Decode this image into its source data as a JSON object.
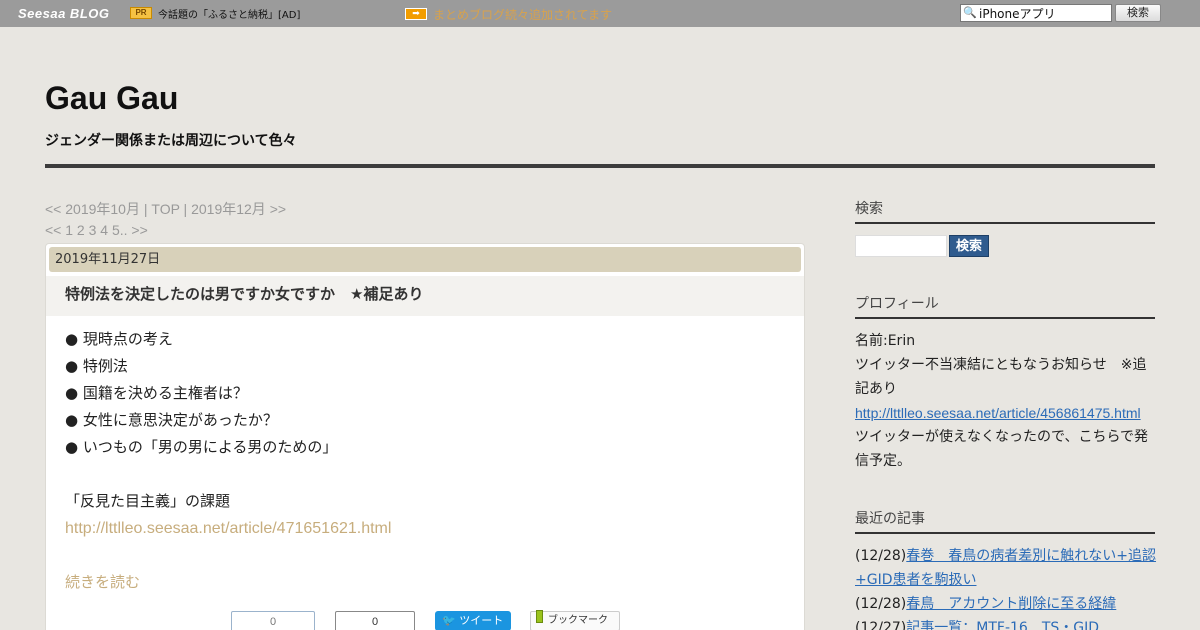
{
  "topbar": {
    "logo": "Seesaa BLOG",
    "pr_badge": "PR",
    "ad_text": "今話題の「ふるさと納税」[AD]",
    "arrow_badge": "➡",
    "news": "まとめブログ続々追加されてます",
    "search_value": "iPhoneアプリ",
    "search_button": "検索"
  },
  "header": {
    "title": "Gau Gau",
    "description": "ジェンダー関係または周辺について色々"
  },
  "pager": {
    "prev": "<< 2019年10月",
    "sep1": " | ",
    "top": "TOP",
    "sep2": " | ",
    "next": "2019年12月 >>",
    "pages": "<< 1 2 3 4 5.. >>"
  },
  "article": {
    "date": "2019年11月27日",
    "title": "特例法を決定したのは男ですか女ですか　★補足あり",
    "bullets": [
      "● 現時点の考え",
      "● 特例法",
      "● 国籍を決める主権者は？",
      "● 女性に意思決定があったか？",
      "● いつもの「男の男による男のための」"
    ],
    "subheading": "「反見た目主義」の課題",
    "link": "http://lttlleo.seesaa.net/article/471651621.html",
    "more": "続きを読む",
    "count1": "0",
    "count2": "0",
    "tweet_label": "ツイート",
    "tweet_icon": "twitter-bird-icon",
    "bookmark_label": "ブックマーク"
  },
  "sidebar": {
    "search_heading": "検索",
    "search_button": "検索",
    "profile_heading": "プロフィール",
    "profile_lines": [
      "名前:Erin",
      "ツイッター不当凍結にともなうお知らせ　※追",
      "記あり"
    ],
    "profile_link": "http://lttlleo.seesaa.net/article/456861475.html",
    "profile_after": [
      "ツイッターが使えなくなったので、こちらで発",
      "信予定。"
    ],
    "recent_heading": "最近の記事",
    "recent": [
      {
        "date": "(12/28)",
        "title": "春巻　春鳥の病者差別に触れない+追認"
      },
      {
        "date": "",
        "title": "+GID患者を駒扱い"
      },
      {
        "date": "(12/28)",
        "title": "春鳥　アカウント削除に至る経緯"
      },
      {
        "date": "(12/27)",
        "title": "記事一覧：MTF-16　TS・GID"
      }
    ]
  }
}
